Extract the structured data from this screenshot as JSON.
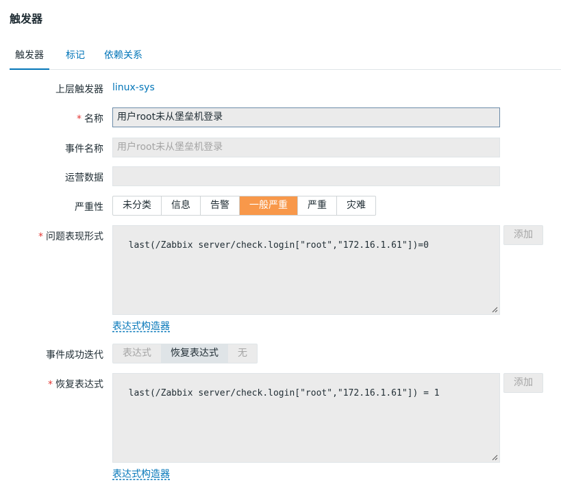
{
  "page": {
    "title": "触发器"
  },
  "tabs": [
    {
      "label": "触发器",
      "active": true
    },
    {
      "label": "标记",
      "active": false
    },
    {
      "label": "依赖关系",
      "active": false
    }
  ],
  "form": {
    "parent": {
      "label": "上层触发器",
      "value": "linux-sys"
    },
    "name": {
      "required_mark": "*",
      "label": "名称",
      "value": "用户root未从堡垒机登录"
    },
    "event_name": {
      "label": "事件名称",
      "placeholder": "用户root未从堡垒机登录"
    },
    "opdata": {
      "label": "运营数据",
      "value": ""
    },
    "severity": {
      "label": "严重性",
      "options": [
        "未分类",
        "信息",
        "告警",
        "一般严重",
        "严重",
        "灾难"
      ],
      "selected": "一般严重"
    },
    "problem_expression": {
      "required_mark": "*",
      "label": "问题表现形式",
      "value": "last(/Zabbix server/check.login[\"root\",\"172.16.1.61\"])=0",
      "add_button": "添加",
      "builder_link": "表达式构造器"
    },
    "ok_event_generation": {
      "label": "事件成功迭代",
      "options": [
        "表达式",
        "恢复表达式",
        "无"
      ],
      "selected": "恢复表达式"
    },
    "recovery_expression": {
      "required_mark": "*",
      "label": "恢复表达式",
      "value": "last(/Zabbix server/check.login[\"root\",\"172.16.1.61\"]) = 1",
      "add_button": "添加",
      "builder_link": "表达式构造器"
    }
  },
  "colors": {
    "link": "#0275b8",
    "severity_average": "#f8984a",
    "required": "#e33734"
  }
}
